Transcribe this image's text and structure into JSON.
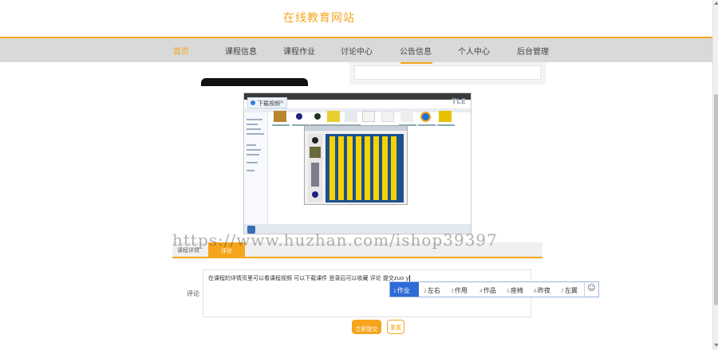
{
  "site": {
    "title": "在线教育网站"
  },
  "nav": {
    "items": [
      {
        "label": "首页",
        "active": true
      },
      {
        "label": "课程信息",
        "active": false
      },
      {
        "label": "课程作业",
        "active": false
      },
      {
        "label": "讨论中心",
        "active": false
      },
      {
        "label": "公告信息",
        "active": false
      },
      {
        "label": "个人中心",
        "active": false
      },
      {
        "label": "后台管理",
        "active": false
      }
    ]
  },
  "video": {
    "tab_label": "下载视频",
    "tab_close": "×",
    "logo_text": "TLE"
  },
  "watermark": "https://www.huzhan.com/ishop39397",
  "detail_tabs": {
    "first": "课程详情",
    "second": "评论"
  },
  "comment": {
    "label": "评论",
    "text": "在课程的详情页里可以看课程视频 可以下载课件  登录后可以收藏 评论  提交zuo y"
  },
  "ime": {
    "candidates": [
      {
        "num": "1",
        "text": "作业"
      },
      {
        "num": "2",
        "text": "左右"
      },
      {
        "num": "3",
        "text": "作用"
      },
      {
        "num": "4",
        "text": "作品"
      },
      {
        "num": "5",
        "text": "座椅"
      },
      {
        "num": "6",
        "text": "昨夜"
      },
      {
        "num": "7",
        "text": "左翼"
      }
    ],
    "emoji": "☺"
  },
  "buttons": {
    "submit": "立即提交",
    "reset": "重置"
  },
  "colors": {
    "accent": "#f5a51b",
    "nav_bg": "#d9d9d9",
    "ime_selected": "#2d6bd6"
  }
}
